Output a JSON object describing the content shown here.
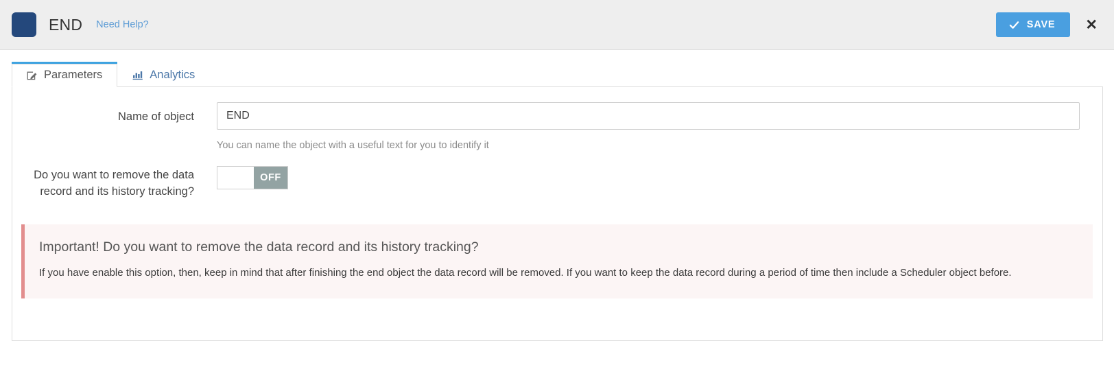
{
  "header": {
    "object_icon": "rounded-square-icon",
    "icon_color": "#24487c",
    "title": "END",
    "help_link": "Need Help?",
    "save_label": "SAVE",
    "save_icon": "check-icon",
    "save_color": "#4a9fe0",
    "close_icon": "✕"
  },
  "tabs": [
    {
      "label": "Parameters",
      "icon": "edit-pencil-square-icon",
      "active": true
    },
    {
      "label": "Analytics",
      "icon": "bar-chart-icon",
      "active": false
    }
  ],
  "form": {
    "name_label": "Name of object",
    "name_value": "END",
    "name_placeholder": "Name of object",
    "name_help": "You can name the object with a useful text for you to identify it",
    "toggle_label": "Do you want to remove the data record and its history tracking?",
    "toggle_state": "OFF",
    "toggle_on_color": "#93a3a3"
  },
  "alert": {
    "title": "Important! Do you want to remove the data record and its history tracking?",
    "body": "If you have enable this option, then, keep in mind that after finishing the end object the data record will be removed. If you want to keep the data record during a period of time then include a Scheduler object before.",
    "accent_color": "#e28e8e",
    "background_color": "#fcf5f5"
  }
}
